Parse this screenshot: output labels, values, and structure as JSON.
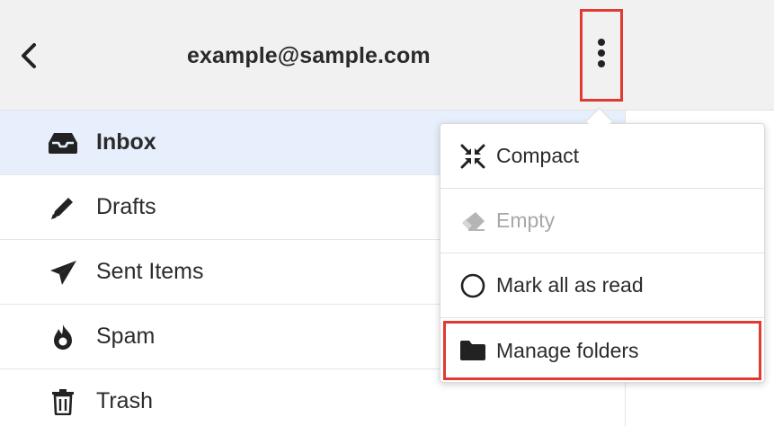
{
  "header": {
    "title": "example@sample.com",
    "back_icon": "chevron-left-icon",
    "menu_icon": "kebab-vertical-icon",
    "highlight_color": "#e03a33"
  },
  "folders": [
    {
      "label": "Inbox",
      "icon": "inbox-tray-icon",
      "active": true
    },
    {
      "label": "Drafts",
      "icon": "pencil-icon",
      "active": false
    },
    {
      "label": "Sent Items",
      "icon": "paper-plane-icon",
      "active": false
    },
    {
      "label": "Spam",
      "icon": "flame-icon",
      "active": false
    },
    {
      "label": "Trash",
      "icon": "trash-can-icon",
      "active": false
    }
  ],
  "menu": {
    "items": [
      {
        "label": "Compact",
        "icon": "compress-icon",
        "enabled": true
      },
      {
        "label": "Empty",
        "icon": "eraser-icon",
        "enabled": false
      },
      {
        "label": "Mark all as read",
        "icon": "circle-outline-icon",
        "enabled": true
      },
      {
        "label": "Manage folders",
        "icon": "folder-icon",
        "enabled": true,
        "highlighted": true
      }
    ]
  },
  "colors": {
    "header_bg": "#f1f1f1",
    "active_row_bg": "#e6effb",
    "highlight_border": "#e03a33",
    "disabled_text": "#a8a8a8"
  }
}
